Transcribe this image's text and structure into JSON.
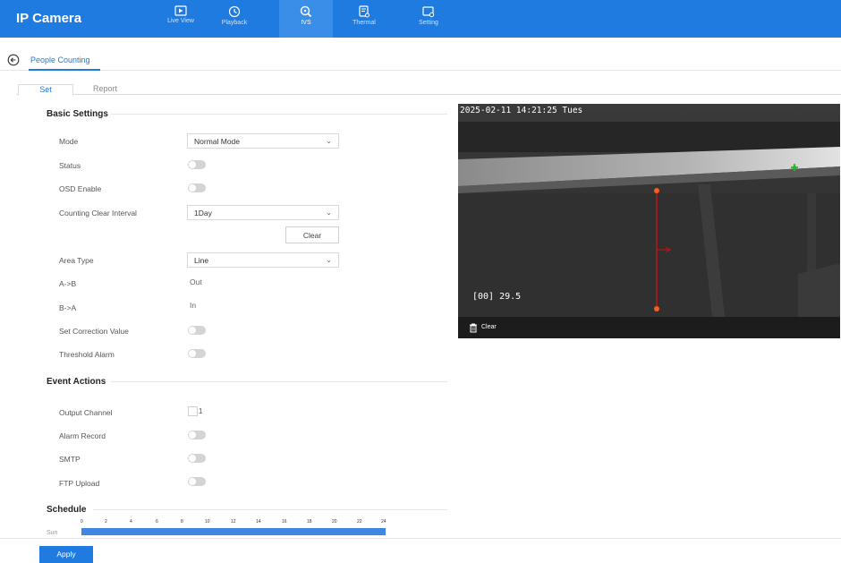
{
  "app": {
    "title": "IP Camera"
  },
  "nav": [
    {
      "label": "Live View",
      "icon": "live-view-icon"
    },
    {
      "label": "Playback",
      "icon": "playback-icon"
    },
    {
      "label": "IVS",
      "icon": "ivs-icon",
      "active": true
    },
    {
      "label": "Thermal",
      "icon": "thermal-icon"
    },
    {
      "label": "Setting",
      "icon": "setting-icon"
    }
  ],
  "breadcrumb": {
    "title": "People Counting"
  },
  "tabs": [
    {
      "label": "Set",
      "active": true
    },
    {
      "label": "Report"
    }
  ],
  "basic": {
    "heading": "Basic Settings",
    "mode_label": "Mode",
    "mode_value": "Normal Mode",
    "status_label": "Status",
    "osd_label": "OSD Enable",
    "interval_label": "Counting Clear Interval",
    "interval_value": "1Day",
    "clear_button": "Clear",
    "area_type_label": "Area Type",
    "area_type_value": "Line",
    "ab_label": "A->B",
    "ab_value": "Out",
    "ba_label": "B->A",
    "ba_value": "In",
    "correction_label": "Set Correction Value",
    "threshold_label": "Threshold Alarm"
  },
  "events": {
    "heading": "Event Actions",
    "output_label": "Output Channel",
    "output_value": "1",
    "alarm_record_label": "Alarm Record",
    "smtp_label": "SMTP",
    "ftp_label": "FTP Upload"
  },
  "schedule": {
    "heading": "Schedule",
    "hours": [
      "0",
      "2",
      "4",
      "6",
      "8",
      "10",
      "12",
      "14",
      "16",
      "18",
      "20",
      "22",
      "24"
    ],
    "day": "Sun"
  },
  "apply_button": "Apply",
  "video": {
    "timestamp": "2025-02-11 14:21:25 Tues",
    "count_overlay": "[00] 29.5",
    "clear_label": "Clear"
  },
  "colors": {
    "accent": "#1f7be0",
    "line": "#cc1111",
    "endpoint": "#ff5a1f",
    "marker": "#22bb22"
  }
}
